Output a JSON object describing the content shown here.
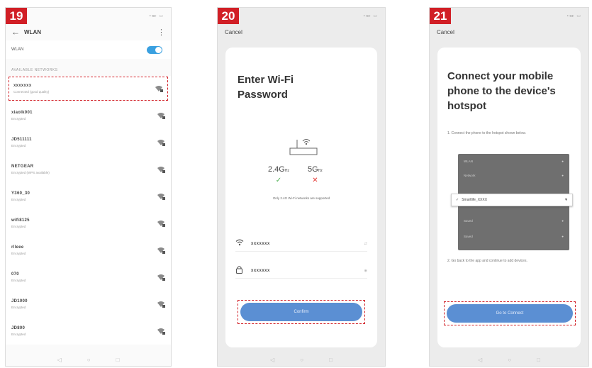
{
  "steps": {
    "s19": "19",
    "s20": "20",
    "s21": "21"
  },
  "statusbar": {
    "dots": "▪◂▸ ▭"
  },
  "p19": {
    "title": "WLAN",
    "toggle_label": "WLAN",
    "toggle_on": true,
    "section": "AVAILABLE NETWORKS",
    "networks": [
      {
        "name": "xxxxxxx",
        "status": "Connected (good quality)"
      },
      {
        "name": "xiaolk001",
        "status": "Encrypted"
      },
      {
        "name": "JD511111",
        "status": "Encrypted"
      },
      {
        "name": "NETGEAR",
        "status": "Encrypted (WPS available)"
      },
      {
        "name": "Y360_30",
        "status": "Encrypted"
      },
      {
        "name": "wifi8125",
        "status": "Encrypted"
      },
      {
        "name": "rlleee",
        "status": "Encrypted"
      },
      {
        "name": "070",
        "status": "Encrypted"
      },
      {
        "name": "JD1000",
        "status": "Encrypted"
      },
      {
        "name": "JD800",
        "status": "Encrypted"
      }
    ]
  },
  "p20": {
    "cancel": "Cancel",
    "title": "Enter Wi-Fi Password",
    "band_24": "2.4G",
    "band_5": "5G",
    "unit": "Hz",
    "check": "✓",
    "cross": "✕",
    "note": "Only 2.4G Wi-Fi networks are supported",
    "ssid_value": "xxxxxxx",
    "password_value": "xxxxxxx",
    "ssid_aux": "⇄",
    "password_aux": "◉",
    "confirm": "Confirm"
  },
  "p21": {
    "cancel": "Cancel",
    "title": "Connect your mobile phone to the device's hotspot",
    "step1": "1. Connect the phone to the hotspot shown below.",
    "mini_rows": [
      "WLAN",
      "Network",
      "",
      "Saved",
      "Saved"
    ],
    "hotspot": "Smartlife_XXXX",
    "step2": "2. Go back to the app and continue to add devices.",
    "go_btn": "Go to Connect"
  },
  "colors": {
    "badge": "#d11f26",
    "primary_button": "#5b8fd3",
    "toggle": "#3aa0e0",
    "dashed_highlight": "#d11f26"
  }
}
